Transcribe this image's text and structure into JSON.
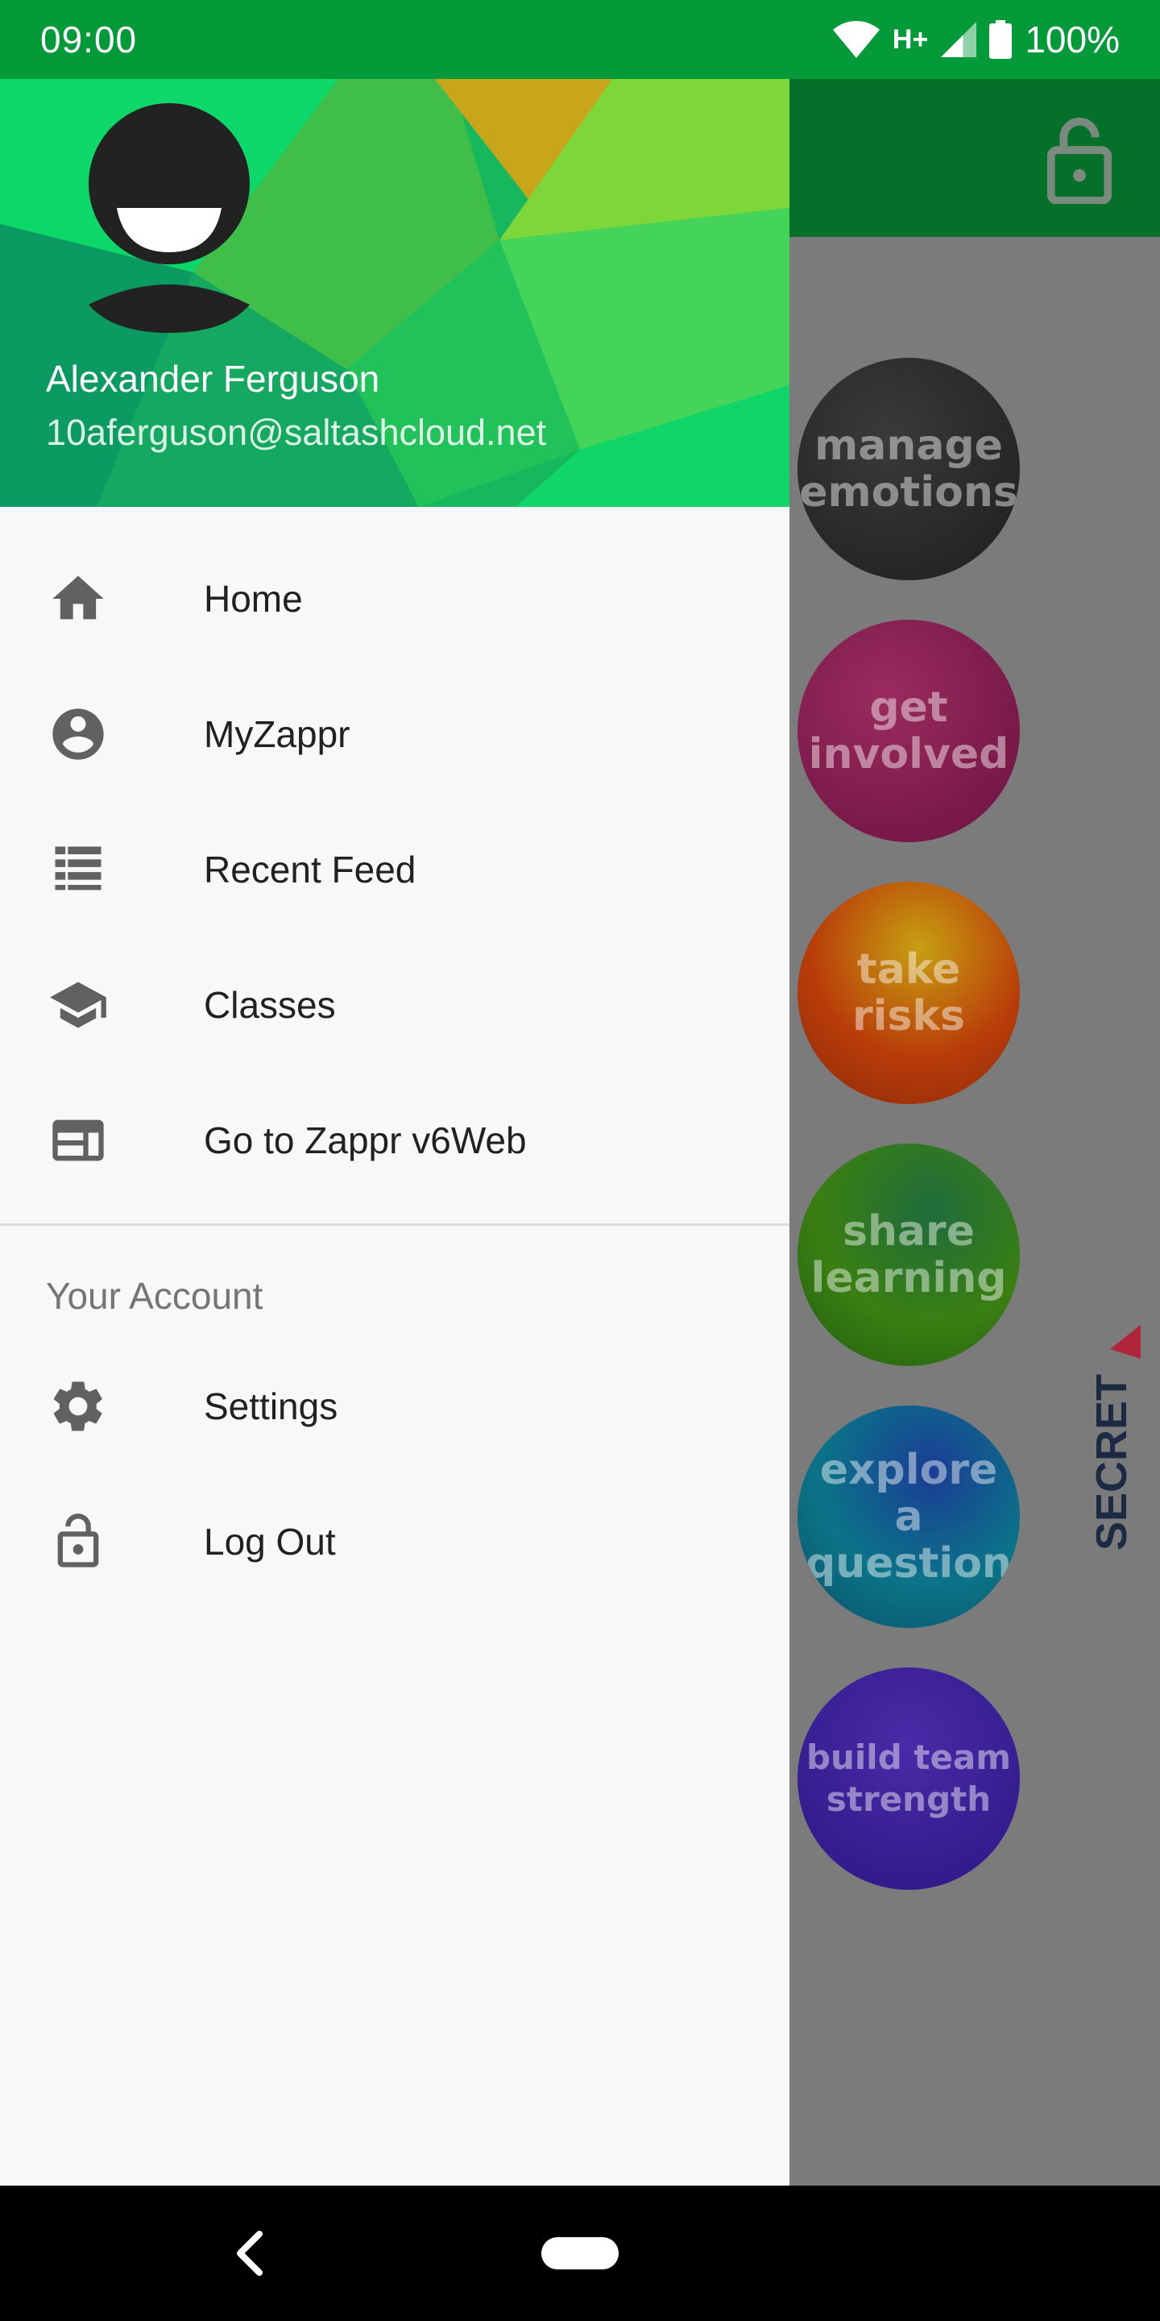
{
  "status_bar": {
    "time": "09:00",
    "network": "H+",
    "battery": "100%",
    "icons": [
      "wifi-icon",
      "cell-signal-icon",
      "battery-icon"
    ]
  },
  "app": {
    "toolbar_icon": "lock-open-icon",
    "badges": [
      {
        "text": "manage emotions",
        "color": "#2b2b2b"
      },
      {
        "text": "get involved",
        "color": "#8e1a55"
      },
      {
        "text": "take risks",
        "color": "#c2420c"
      },
      {
        "text": "share learning",
        "color": "#2f7a16"
      },
      {
        "text": "explore a question",
        "color": "#0a6f8a"
      },
      {
        "text": "build team strength",
        "color": "#3a1d92"
      }
    ],
    "logo_text": "SECRET"
  },
  "drawer": {
    "user": {
      "name": "Alexander Ferguson",
      "email": "10aferguson@saltashcloud.net"
    },
    "menu": [
      {
        "label": "Home",
        "icon": "home-icon"
      },
      {
        "label": "MyZappr",
        "icon": "account-circle-icon"
      },
      {
        "label": "Recent Feed",
        "icon": "list-icon"
      },
      {
        "label": "Classes",
        "icon": "graduation-cap-icon"
      },
      {
        "label": "Go to Zappr v6Web",
        "icon": "web-icon"
      }
    ],
    "account_section": {
      "title": "Your Account",
      "items": [
        {
          "label": "Settings",
          "icon": "gear-icon"
        },
        {
          "label": "Log Out",
          "icon": "lock-open-icon"
        }
      ]
    }
  },
  "nav_bar": {
    "icons": [
      "back-icon",
      "home-pill"
    ]
  },
  "colors": {
    "status_bar": "#049a3a",
    "toolbar": "#04702a",
    "drawer_bg": "#f8f8f8",
    "icon_gray": "#616161"
  }
}
